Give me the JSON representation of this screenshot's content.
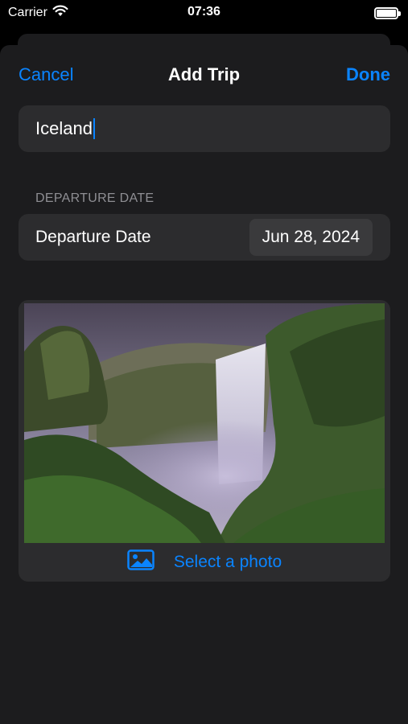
{
  "status_bar": {
    "carrier": "Carrier",
    "time": "07:36",
    "battery_level": 1.0
  },
  "nav": {
    "cancel_label": "Cancel",
    "title": "Add Trip",
    "done_label": "Done"
  },
  "form": {
    "trip_name": "Iceland",
    "departure_section_header": "DEPARTURE DATE",
    "departure_label": "Departure Date",
    "departure_value": "Jun 28, 2024",
    "select_photo_label": "Select a photo"
  },
  "colors": {
    "accent": "#0a84ff",
    "sheet_background": "#1c1c1e",
    "row_background": "#2c2c2e"
  },
  "icons": [
    "wifi-icon",
    "battery-icon",
    "photo-icon"
  ],
  "photo": {
    "subject": "waterfall-landscape"
  }
}
